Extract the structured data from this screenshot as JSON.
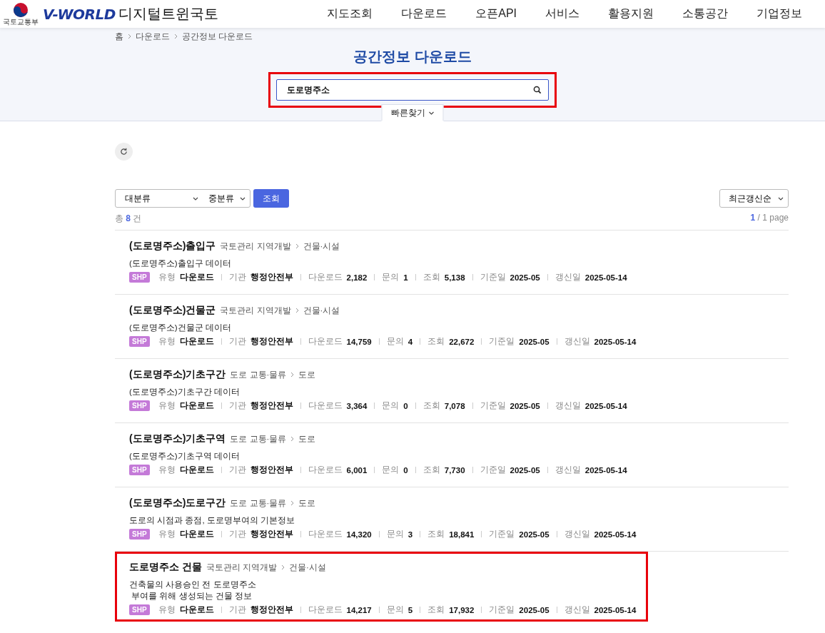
{
  "header": {
    "ministry": "국토교통부",
    "logo": "V-WORLD",
    "service": "디지털트윈국토",
    "nav": [
      "지도조회",
      "다운로드",
      "오픈API",
      "서비스",
      "활용지원",
      "소통공간",
      "기업정보"
    ]
  },
  "breadcrumb": [
    "홈",
    "다운로드",
    "공간정보 다운로드"
  ],
  "page_title": "공간정보 다운로드",
  "search": {
    "value": "도로명주소",
    "highlighted": true
  },
  "quick_find": "빠른찾기",
  "filters": {
    "category": "대분류",
    "subcategory": "중분류",
    "submit": "조회",
    "sort": "최근갱신순"
  },
  "summary": {
    "prefix": "총",
    "count": "8",
    "suffix": "건",
    "page_current": "1",
    "page_total": "/ 1 page"
  },
  "results": [
    {
      "title": "(도로명주소)출입구",
      "path": [
        "국토관리 지역개발",
        "건물·시설"
      ],
      "description": "(도로명주소)출입구 데이터",
      "format": "SHP",
      "highlighted": false,
      "meta": [
        {
          "label": "유형",
          "value": "다운로드"
        },
        {
          "label": "기관",
          "value": "행정안전부"
        },
        {
          "label": "다운로드",
          "value": "2,182"
        },
        {
          "label": "문의",
          "value": "1"
        },
        {
          "label": "조회",
          "value": "5,138"
        },
        {
          "label": "기준일",
          "value": "2025-05"
        },
        {
          "label": "갱신일",
          "value": "2025-05-14"
        }
      ]
    },
    {
      "title": "(도로명주소)건물군",
      "path": [
        "국토관리 지역개발",
        "건물·시설"
      ],
      "description": "(도로명주소)건물군 데이터",
      "format": "SHP",
      "highlighted": false,
      "meta": [
        {
          "label": "유형",
          "value": "다운로드"
        },
        {
          "label": "기관",
          "value": "행정안전부"
        },
        {
          "label": "다운로드",
          "value": "14,759"
        },
        {
          "label": "문의",
          "value": "4"
        },
        {
          "label": "조회",
          "value": "22,672"
        },
        {
          "label": "기준일",
          "value": "2025-05"
        },
        {
          "label": "갱신일",
          "value": "2025-05-14"
        }
      ]
    },
    {
      "title": "(도로명주소)기초구간",
      "path": [
        "도로 교통·물류",
        "도로"
      ],
      "description": "(도로명주소)기초구간 데이터",
      "format": "SHP",
      "highlighted": false,
      "meta": [
        {
          "label": "유형",
          "value": "다운로드"
        },
        {
          "label": "기관",
          "value": "행정안전부"
        },
        {
          "label": "다운로드",
          "value": "3,364"
        },
        {
          "label": "문의",
          "value": "0"
        },
        {
          "label": "조회",
          "value": "7,078"
        },
        {
          "label": "기준일",
          "value": "2025-05"
        },
        {
          "label": "갱신일",
          "value": "2025-05-14"
        }
      ]
    },
    {
      "title": "(도로명주소)기초구역",
      "path": [
        "도로 교통·물류",
        "도로"
      ],
      "description": "(도로명주소)기초구역 데이터",
      "format": "SHP",
      "highlighted": false,
      "meta": [
        {
          "label": "유형",
          "value": "다운로드"
        },
        {
          "label": "기관",
          "value": "행정안전부"
        },
        {
          "label": "다운로드",
          "value": "6,001"
        },
        {
          "label": "문의",
          "value": "0"
        },
        {
          "label": "조회",
          "value": "7,730"
        },
        {
          "label": "기준일",
          "value": "2025-05"
        },
        {
          "label": "갱신일",
          "value": "2025-05-14"
        }
      ]
    },
    {
      "title": "(도로명주소)도로구간",
      "path": [
        "도로 교통·물류",
        "도로"
      ],
      "description": "도로의 시점과 종점, 도로명부여의 기본정보",
      "format": "SHP",
      "highlighted": false,
      "meta": [
        {
          "label": "유형",
          "value": "다운로드"
        },
        {
          "label": "기관",
          "value": "행정안전부"
        },
        {
          "label": "다운로드",
          "value": "14,320"
        },
        {
          "label": "문의",
          "value": "3"
        },
        {
          "label": "조회",
          "value": "18,841"
        },
        {
          "label": "기준일",
          "value": "2025-05"
        },
        {
          "label": "갱신일",
          "value": "2025-05-14"
        }
      ]
    },
    {
      "title": "도로명주소 건물",
      "path": [
        "국토관리 지역개발",
        "건물·시설"
      ],
      "description": "건축물의 사용승인 전 도로명주소\n 부여를 위해 생성되는 건물 정보",
      "format": "SHP",
      "highlighted": true,
      "meta": [
        {
          "label": "유형",
          "value": "다운로드"
        },
        {
          "label": "기관",
          "value": "행정안전부"
        },
        {
          "label": "다운로드",
          "value": "14,217"
        },
        {
          "label": "문의",
          "value": "5"
        },
        {
          "label": "조회",
          "value": "17,932"
        },
        {
          "label": "기준일",
          "value": "2025-05"
        },
        {
          "label": "갱신일",
          "value": "2025-05-14"
        }
      ]
    }
  ]
}
